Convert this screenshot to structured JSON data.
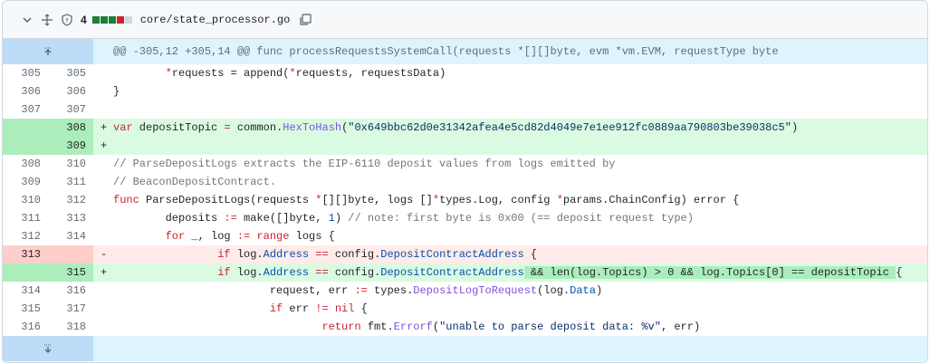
{
  "header": {
    "change_count": "4",
    "diffstat_colors": [
      "#1a7f37",
      "#1a7f37",
      "#1a7f37",
      "#cf222e",
      "#d0d7de"
    ],
    "filename": "core/state_processor.go",
    "icons": [
      "chevron-down-icon",
      "move-icon",
      "shield-icon",
      "copy-icon"
    ]
  },
  "hunk": {
    "header": "@@ -305,12 +305,14 @@ func processRequestsSystemCall(requests *[][]byte, evm *vm.EVM, requestType byte"
  },
  "lines": [
    {
      "old": "305",
      "new": "305",
      "type": "ctx",
      "marker": " ",
      "tokens": [
        [
          "",
          "        "
        ],
        [
          "kw",
          "*"
        ],
        [
          "",
          "requests = append("
        ],
        [
          "kw",
          "*"
        ],
        [
          "",
          "requests, requestsData)"
        ]
      ]
    },
    {
      "old": "306",
      "new": "306",
      "type": "ctx",
      "marker": " ",
      "tokens": [
        [
          "",
          "}"
        ]
      ]
    },
    {
      "old": "307",
      "new": "307",
      "type": "ctx",
      "marker": " ",
      "tokens": [
        [
          "",
          ""
        ]
      ]
    },
    {
      "old": "",
      "new": "308",
      "type": "add",
      "marker": "+",
      "tokens": [
        [
          "kw",
          "var"
        ],
        [
          "",
          " depositTopic "
        ],
        [
          "kw",
          "="
        ],
        [
          "",
          " common."
        ],
        [
          "fn",
          "HexToHash"
        ],
        [
          "",
          "("
        ],
        [
          "str",
          "\"0x649bbc62d0e31342afea4e5cd82d4049e7e1ee912fc0889aa790803be39038c5\""
        ],
        [
          "",
          ")"
        ]
      ]
    },
    {
      "old": "",
      "new": "309",
      "type": "add",
      "marker": "+",
      "tokens": [
        [
          "",
          ""
        ]
      ]
    },
    {
      "old": "308",
      "new": "310",
      "type": "ctx",
      "marker": " ",
      "tokens": [
        [
          "cm",
          "// ParseDepositLogs extracts the EIP-6110 deposit values from logs emitted by"
        ]
      ]
    },
    {
      "old": "309",
      "new": "311",
      "type": "ctx",
      "marker": " ",
      "tokens": [
        [
          "cm",
          "// BeaconDepositContract."
        ]
      ]
    },
    {
      "old": "310",
      "new": "312",
      "type": "ctx",
      "marker": " ",
      "tokens": [
        [
          "kw",
          "func"
        ],
        [
          "",
          " ParseDepositLogs(requests "
        ],
        [
          "kw",
          "*"
        ],
        [
          "",
          "[][]byte, logs []"
        ],
        [
          "kw",
          "*"
        ],
        [
          "",
          "types.Log, config "
        ],
        [
          "kw",
          "*"
        ],
        [
          "",
          "params.ChainConfig) error {"
        ]
      ]
    },
    {
      "old": "311",
      "new": "313",
      "type": "ctx",
      "marker": " ",
      "tokens": [
        [
          "",
          "        deposits "
        ],
        [
          "kw",
          ":="
        ],
        [
          "",
          " make([]byte, "
        ],
        [
          "cst",
          "1"
        ],
        [
          "",
          ") "
        ],
        [
          "cm",
          "// note: first byte is 0x00 (== deposit request type)"
        ]
      ]
    },
    {
      "old": "312",
      "new": "314",
      "type": "ctx",
      "marker": " ",
      "tokens": [
        [
          "",
          "        "
        ],
        [
          "kw",
          "for"
        ],
        [
          "",
          " _, log "
        ],
        [
          "kw",
          ":="
        ],
        [
          "",
          " "
        ],
        [
          "kw",
          "range"
        ],
        [
          "",
          " logs {"
        ]
      ]
    },
    {
      "old": "313",
      "new": "",
      "type": "del",
      "marker": "-",
      "tokens": [
        [
          "",
          "                "
        ],
        [
          "kw",
          "if"
        ],
        [
          "",
          " log."
        ],
        [
          "cst",
          "Address"
        ],
        [
          "",
          " "
        ],
        [
          "kw",
          "=="
        ],
        [
          "",
          " config."
        ],
        [
          "cst",
          "DepositContractAddress"
        ],
        [
          "",
          " {"
        ]
      ]
    },
    {
      "old": "",
      "new": "315",
      "type": "add",
      "marker": "+",
      "tokens": [
        [
          "",
          "                "
        ],
        [
          "kw",
          "if"
        ],
        [
          "",
          " log."
        ],
        [
          "cst",
          "Address"
        ],
        [
          "",
          " "
        ],
        [
          "kw",
          "=="
        ],
        [
          "",
          " config."
        ],
        [
          "cst",
          "DepositContractAddress"
        ],
        [
          "hl",
          " && len(log.Topics) > 0 && log.Topics[0] == depositTopic "
        ],
        [
          "",
          "{"
        ]
      ]
    },
    {
      "old": "314",
      "new": "316",
      "type": "ctx",
      "marker": " ",
      "tokens": [
        [
          "",
          "                        request, err "
        ],
        [
          "kw",
          ":="
        ],
        [
          "",
          " types."
        ],
        [
          "fn",
          "DepositLogToRequest"
        ],
        [
          "",
          "(log."
        ],
        [
          "cst",
          "Data"
        ],
        [
          "",
          ")"
        ]
      ]
    },
    {
      "old": "315",
      "new": "317",
      "type": "ctx",
      "marker": " ",
      "tokens": [
        [
          "",
          "                        "
        ],
        [
          "kw",
          "if"
        ],
        [
          "",
          " err "
        ],
        [
          "kw",
          "!="
        ],
        [
          "",
          " "
        ],
        [
          "kw",
          "nil"
        ],
        [
          "",
          " {"
        ]
      ]
    },
    {
      "old": "316",
      "new": "318",
      "type": "ctx",
      "marker": " ",
      "tokens": [
        [
          "",
          "                                "
        ],
        [
          "kw",
          "return"
        ],
        [
          "",
          " fmt."
        ],
        [
          "fn",
          "Errorf"
        ],
        [
          "",
          "("
        ],
        [
          "str",
          "\"unable to parse deposit data: %v\""
        ],
        [
          "",
          ", err)"
        ]
      ]
    }
  ],
  "expand_icons": [
    "expand-up-icon",
    "expand-down-icon"
  ]
}
